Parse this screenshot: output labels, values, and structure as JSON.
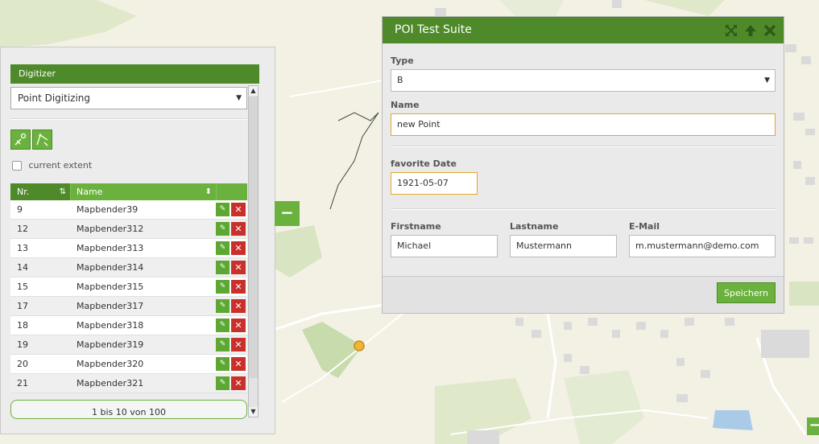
{
  "digitizer": {
    "header": "Digitizer",
    "schema_select": "Point Digitizing",
    "current_extent_label": "current extent",
    "table": {
      "col_nr": "Nr.",
      "col_name": "Name",
      "rows": [
        {
          "nr": "9",
          "name": "Mapbender39"
        },
        {
          "nr": "12",
          "name": "Mapbender312"
        },
        {
          "nr": "13",
          "name": "Mapbender313"
        },
        {
          "nr": "14",
          "name": "Mapbender314"
        },
        {
          "nr": "15",
          "name": "Mapbender315"
        },
        {
          "nr": "17",
          "name": "Mapbender317"
        },
        {
          "nr": "18",
          "name": "Mapbender318"
        },
        {
          "nr": "19",
          "name": "Mapbender319"
        },
        {
          "nr": "20",
          "name": "Mapbender320"
        },
        {
          "nr": "21",
          "name": "Mapbender321"
        }
      ]
    },
    "pager": "1 bis 10 von 100"
  },
  "dialog": {
    "title": "POI Test Suite",
    "type_label": "Type",
    "type_value": "B",
    "name_label": "Name",
    "name_value": "new Point",
    "date_label": "favorite Date",
    "date_value": "1921-05-07",
    "firstname_label": "Firstname",
    "firstname_value": "Michael",
    "lastname_label": "Lastname",
    "lastname_value": "Mustermann",
    "email_label": "E-Mail",
    "email_value": "m.mustermann@demo.com",
    "save_label": "Speichern"
  },
  "colors": {
    "accent": "#6ab23d",
    "accent_dark": "#4f8a2a",
    "delete": "#c9302c",
    "map_bg": "#f3f1e4"
  }
}
